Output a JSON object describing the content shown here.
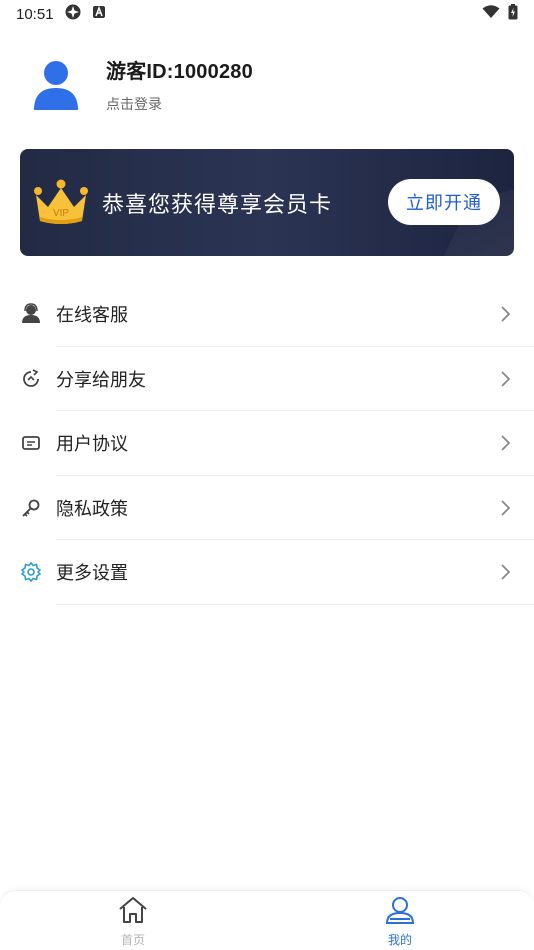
{
  "status_bar": {
    "time": "10:51",
    "icons": [
      "sync-icon",
      "a-icon",
      "wifi-icon",
      "battery-icon"
    ]
  },
  "profile": {
    "name": "游客ID:1000280",
    "sub": "点击登录",
    "avatar_icon": "user-avatar-icon",
    "accent": "#2f6fe8"
  },
  "vip_card": {
    "badge": "VIP",
    "title": "恭喜您获得尊享会员卡",
    "button": "立即开通",
    "bg_color": "#252d49",
    "button_text_color": "#1f5fd6"
  },
  "menu": {
    "items": [
      {
        "label": "在线客服",
        "icon": "customer-service-icon"
      },
      {
        "label": "分享给朋友",
        "icon": "share-icon"
      },
      {
        "label": "用户协议",
        "icon": "agreement-icon"
      },
      {
        "label": "隐私政策",
        "icon": "privacy-key-icon"
      },
      {
        "label": "更多设置",
        "icon": "settings-gear-icon"
      }
    ]
  },
  "bottom_nav": {
    "items": [
      {
        "label": "首页",
        "icon": "home-icon",
        "active": false
      },
      {
        "label": "我的",
        "icon": "profile-icon",
        "active": true
      }
    ],
    "active_color": "#2c6fd8",
    "inactive_color": "#b5b5b5"
  }
}
